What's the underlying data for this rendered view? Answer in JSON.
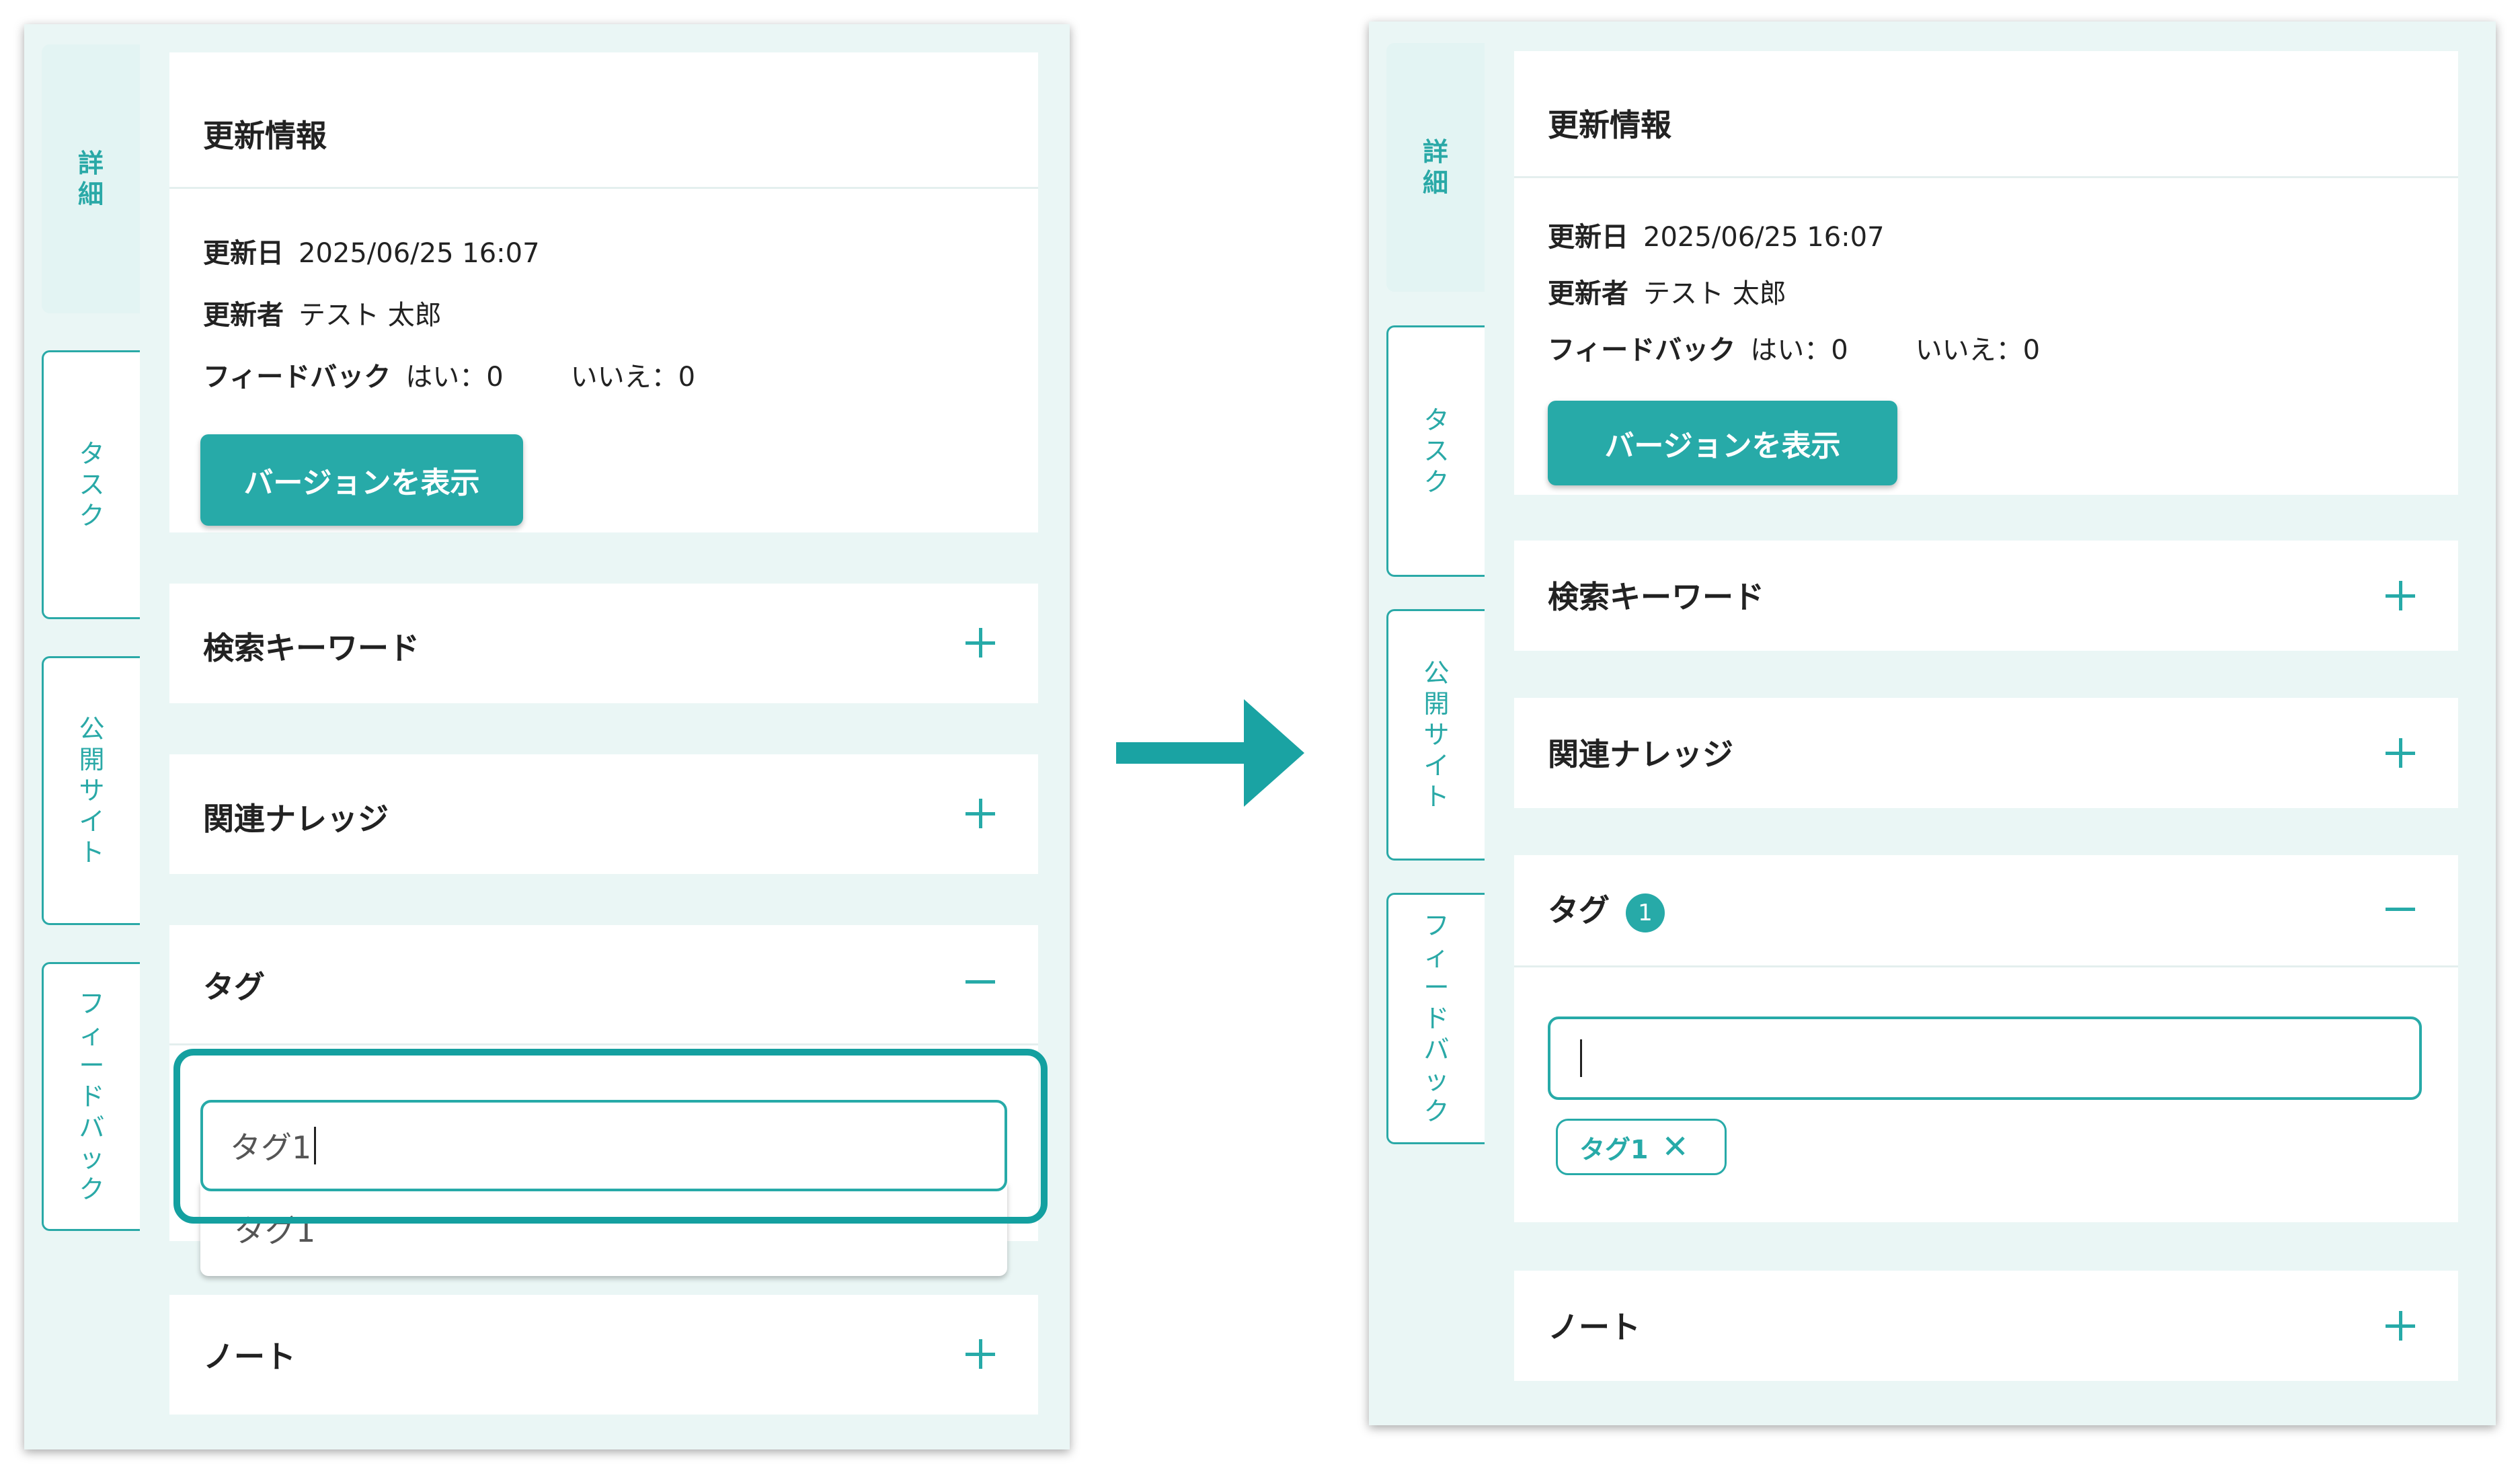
{
  "tabs": {
    "detail": "詳\n細",
    "task": "タ\nス\nク",
    "public": "公\n開\nサ\nイ\nト",
    "feedback": "フ\nィ\nー\nド\nバ\nッ\nク"
  },
  "update": {
    "title": "更新情報",
    "date_label": "更新日",
    "date_value": "2025/06/25 16:07",
    "author_label": "更新者",
    "author_value": "テスト 太郎",
    "feedback_label": "フィードバック",
    "feedback_yes": "はい：0",
    "feedback_no": "いいえ：0",
    "version_button": "バージョンを表示"
  },
  "sections": {
    "keywords": "検索キーワード",
    "related": "関連ナレッジ",
    "tags": "タグ",
    "note": "ノート"
  },
  "before": {
    "tag_input_value": "タグ1",
    "suggestion": "タグ1"
  },
  "after": {
    "tag_count": "1",
    "tag_input_value": "",
    "chip_label": "タグ1",
    "chip_remove": "✕"
  },
  "colors": {
    "accent": "#27aaa8",
    "panel_bg": "#eaf6f5"
  }
}
